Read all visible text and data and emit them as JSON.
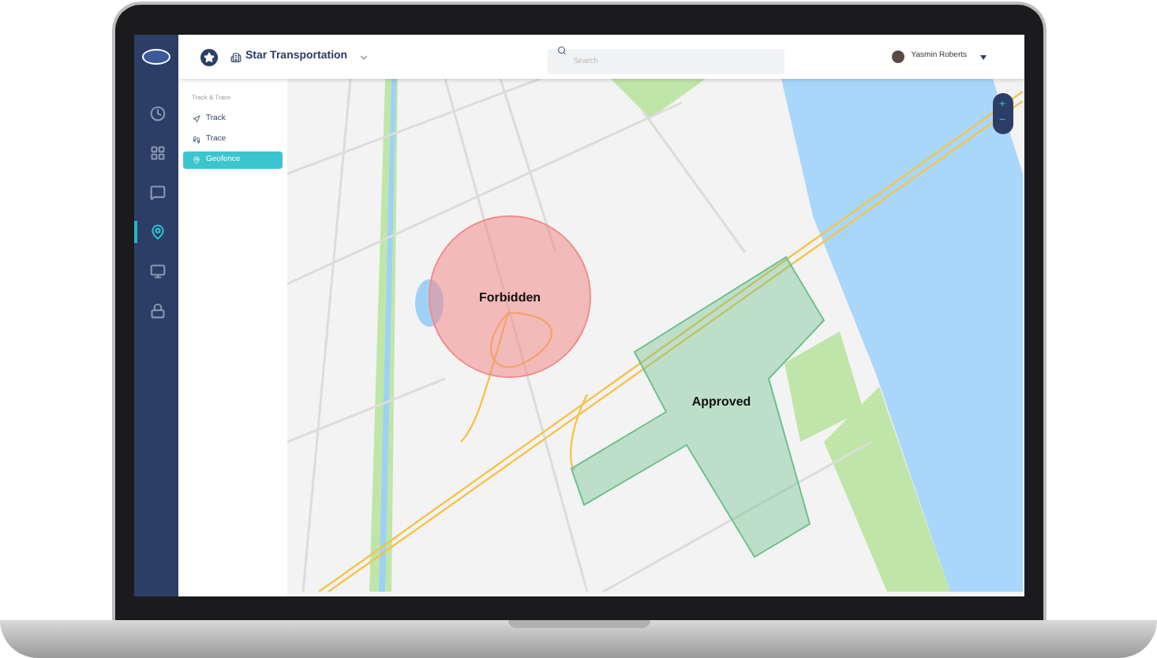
{
  "header": {
    "company": "Star Transportation",
    "search": {
      "placeholder": "Search"
    },
    "user": "Yasmin Roberts"
  },
  "nav": [
    {
      "kind": "clock",
      "selected": false
    },
    {
      "kind": "grid",
      "selected": false
    },
    {
      "kind": "chat",
      "selected": false
    },
    {
      "kind": "pin",
      "selected": true
    },
    {
      "kind": "screen",
      "selected": false
    },
    {
      "kind": "lock",
      "selected": false
    }
  ],
  "submenu": {
    "section": "Track & Trace",
    "items": [
      {
        "label": "Track",
        "kind": "track",
        "selected": false
      },
      {
        "label": "Trace",
        "kind": "trace",
        "selected": false
      },
      {
        "label": "Geofence",
        "kind": "pin",
        "selected": true
      }
    ]
  },
  "map": {
    "zones": [
      {
        "label": "Forbidden",
        "kind": "circle",
        "color": "#f28b8b"
      },
      {
        "label": "Approved",
        "kind": "polygon",
        "color": "#6cc08b"
      }
    ],
    "zoom": [
      "+",
      "−"
    ]
  }
}
